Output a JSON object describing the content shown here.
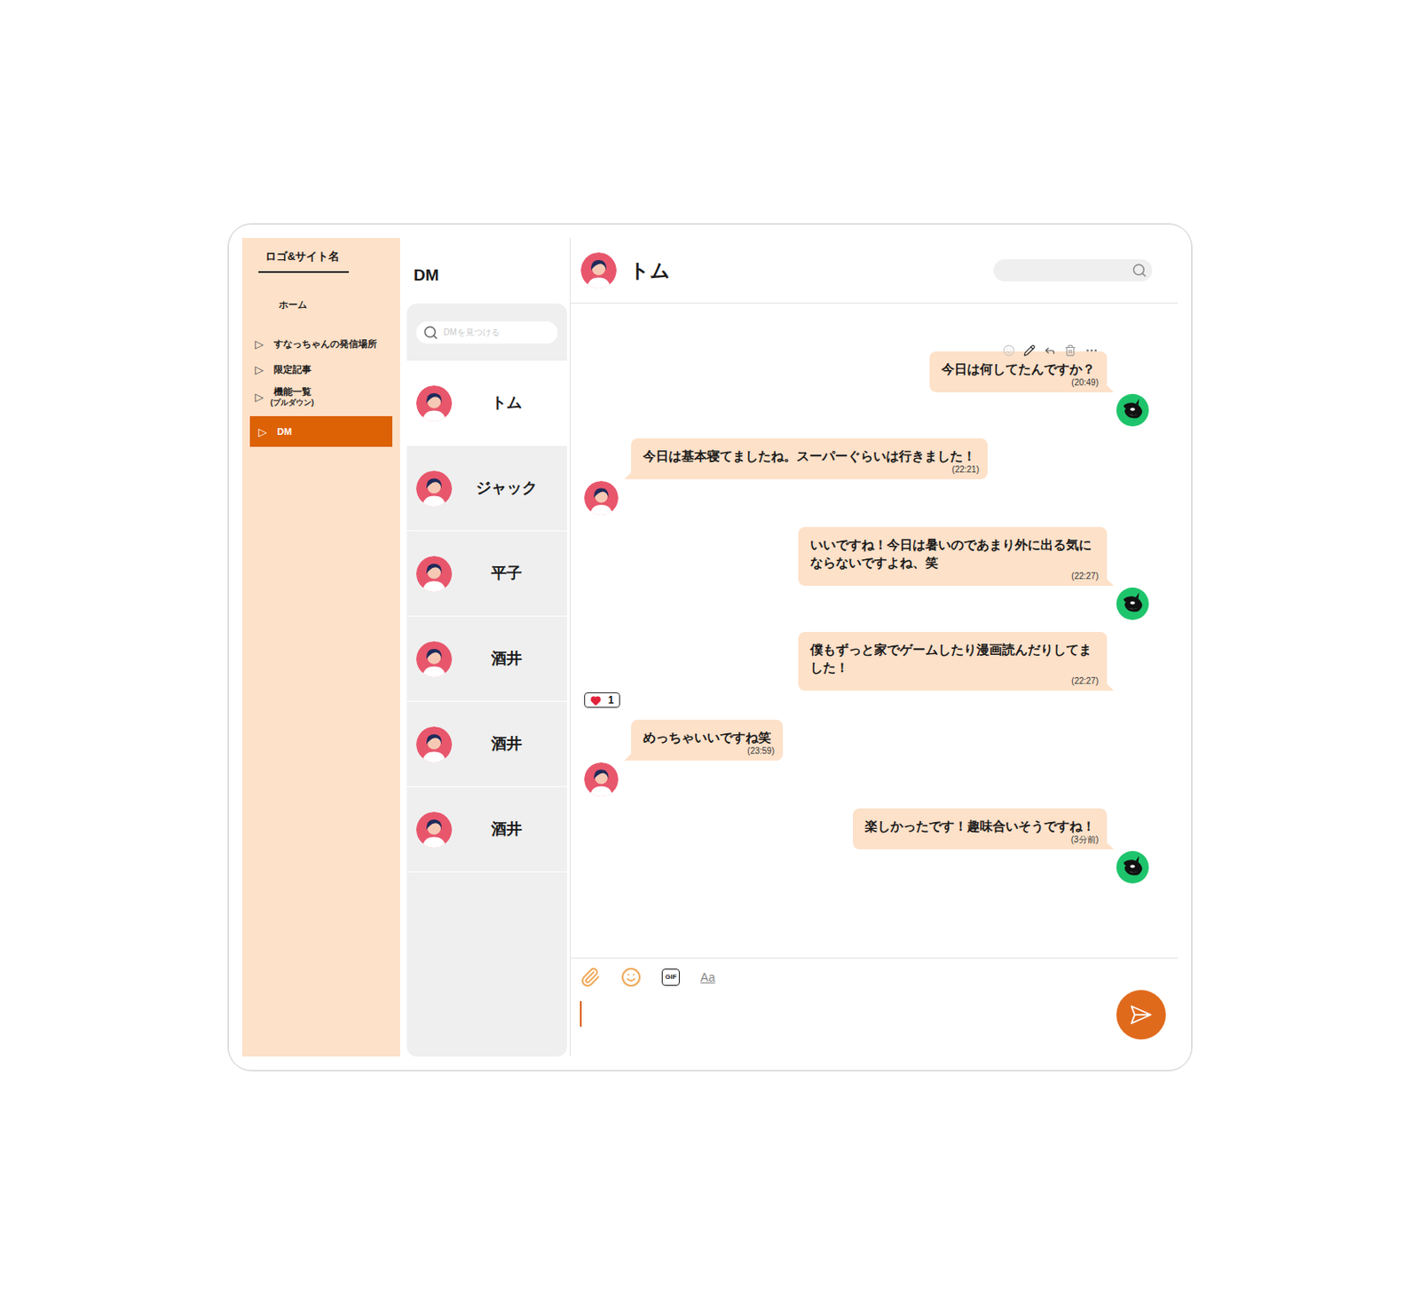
{
  "sidebar": {
    "logo": "ロゴ&サイト名",
    "items": [
      {
        "label": "ホーム",
        "marker": "",
        "sublabel": "",
        "selected": false
      },
      {
        "label": "すなっちゃんの発信場所",
        "marker": "▷",
        "sublabel": "",
        "selected": false
      },
      {
        "label": "限定記事",
        "marker": "▷",
        "sublabel": "",
        "selected": false
      },
      {
        "label": "機能一覧",
        "marker": "▷",
        "sublabel": "(プルダウン)",
        "selected": false
      },
      {
        "label": "DM",
        "marker": "▷",
        "sublabel": "",
        "selected": true
      }
    ]
  },
  "dm_list": {
    "title": "DM",
    "search": {
      "placeholder": "DMを見つける"
    },
    "conversations": [
      {
        "name": "トム",
        "selected": true
      },
      {
        "name": "ジャック",
        "selected": false
      },
      {
        "name": "平子",
        "selected": false
      },
      {
        "name": "酒井",
        "selected": false
      },
      {
        "name": "酒井",
        "selected": false
      },
      {
        "name": "酒井",
        "selected": false
      }
    ]
  },
  "chat": {
    "name": "トム",
    "messages": [
      {
        "kind": "sent",
        "text": "今日は何してたんですか？",
        "time": "(20:49)",
        "show_avatar": true,
        "toolbar_open": true,
        "reactions": []
      },
      {
        "kind": "received",
        "text": "今日は基本寝てましたね。スーパーぐらいは行きました！",
        "time": "(22:21)",
        "show_avatar": true,
        "toolbar_open": false,
        "reactions": []
      },
      {
        "kind": "sent",
        "text": "いいですね！今日は暑いのであまり外に出る気にならないですよね、笑",
        "time": "(22:27)",
        "show_avatar": true,
        "toolbar_open": false,
        "reactions": []
      },
      {
        "kind": "sent",
        "text": "僕もずっと家でゲームしたり漫画読んだりしてました！",
        "time": "(22:27)",
        "show_avatar": false,
        "toolbar_open": false,
        "reactions": [
          {
            "count": "1"
          }
        ]
      },
      {
        "kind": "received",
        "text": "めっちゃいいですね笑",
        "time": "(23:59)",
        "show_avatar": true,
        "toolbar_open": false,
        "reactions": []
      },
      {
        "kind": "sent",
        "text": "楽しかったです！趣味合いそうですね！",
        "time": "(3分前)",
        "show_avatar": true,
        "toolbar_open": false,
        "reactions": []
      }
    ]
  },
  "composer": {
    "tools": [
      {
        "kind": "attach",
        "label": ""
      },
      {
        "kind": "emoji",
        "label": ""
      },
      {
        "kind": "gif",
        "label": "GIF"
      },
      {
        "kind": "format",
        "label": "Aa"
      }
    ]
  }
}
